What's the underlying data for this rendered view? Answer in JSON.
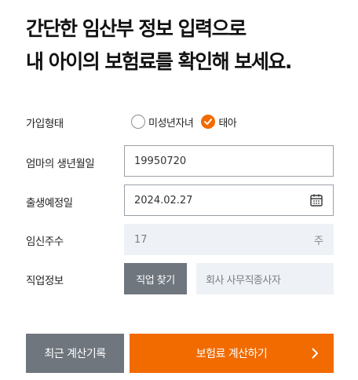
{
  "headline": {
    "line1": "간단한 임산부 정보 입력으로",
    "line2": "내 아이의 보험료를 확인해 보세요."
  },
  "form": {
    "subscription_type": {
      "label": "가입형태",
      "options": [
        {
          "label": "미성년자녀",
          "checked": false
        },
        {
          "label": "태아",
          "checked": true
        }
      ]
    },
    "mother_birthdate": {
      "label": "엄마의 생년월일",
      "value": "19950720"
    },
    "due_date": {
      "label": "출생예정일",
      "value": "2024.02.27",
      "icon": "calendar-icon"
    },
    "pregnancy_weeks": {
      "label": "임신주수",
      "value": "17",
      "unit": "주"
    },
    "occupation": {
      "label": "직업정보",
      "button_label": "직업 찾기",
      "value": "회사 사무직종사자"
    }
  },
  "actions": {
    "recent_label": "최근 계산기록",
    "calculate_label": "보험료 계산하기",
    "calculate_icon": "chevron-right-icon"
  },
  "colors": {
    "accent": "#f26b00",
    "secondary_button": "#6f767e",
    "disabled_field": "#eef1f5"
  }
}
